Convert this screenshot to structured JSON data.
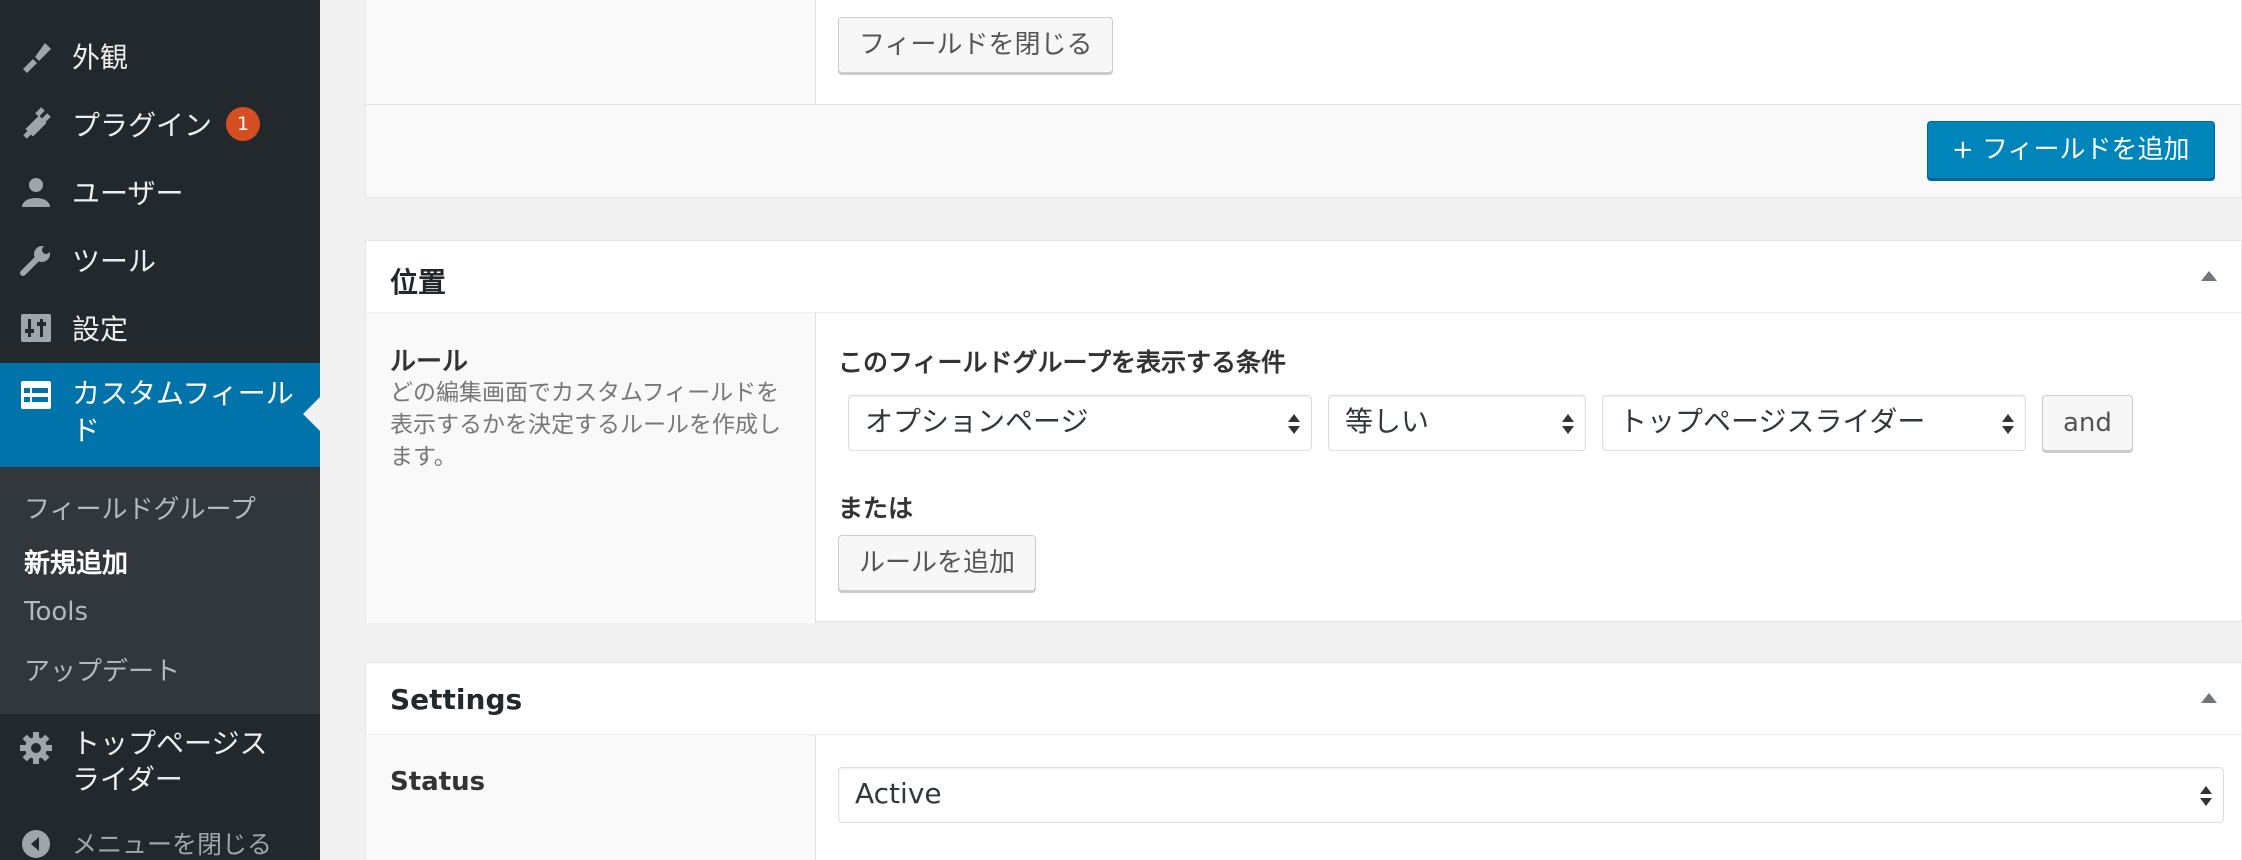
{
  "sidebar": {
    "items": [
      {
        "label": "外観",
        "icon": "paintbrush-icon"
      },
      {
        "label": "プラグイン",
        "icon": "plugin-icon",
        "badge": "1"
      },
      {
        "label": "ユーザー",
        "icon": "user-icon"
      },
      {
        "label": "ツール",
        "icon": "wrench-icon"
      },
      {
        "label": "設定",
        "icon": "settings-sliders-icon"
      }
    ],
    "custom_fields": {
      "label": "カスタムフィールド",
      "icon": "custom-fields-icon"
    },
    "submenu": [
      "フィールドグループ",
      "新規追加",
      "Tools",
      "アップデート"
    ],
    "top_slider": {
      "label": "トップページスライダー",
      "icon": "gear-icon"
    },
    "collapse": {
      "label": "メニューを閉じる",
      "icon": "collapse-arrow-icon"
    }
  },
  "fields_panel": {
    "close_field_button": "フィールドを閉じる",
    "add_field_button": "+ フィールドを追加"
  },
  "location_panel": {
    "title": "位置",
    "rules_label": "ルール",
    "rules_description": "どの編集画面でカスタムフィールドを表示するかを決定するルールを作成します。",
    "condition_title": "このフィールドグループを表示する条件",
    "param_select": "オプションページ",
    "operator_select": "等しい",
    "value_select": "トップページスライダー",
    "and_button": "and",
    "or_label": "または",
    "add_rule_button": "ルールを追加"
  },
  "settings_panel": {
    "title": "Settings",
    "status_label": "Status",
    "status_select": "Active"
  },
  "colors": {
    "sidebar_bg": "#23282d",
    "active_menu": "#0073aa",
    "primary_button": "#0085ba",
    "badge": "#d54e21"
  }
}
